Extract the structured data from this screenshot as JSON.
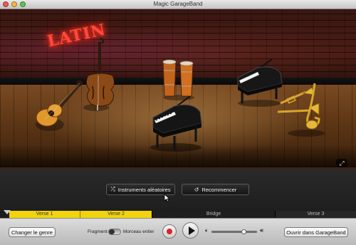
{
  "window": {
    "title": "Magic GarageBand"
  },
  "stage": {
    "sign_text": "LATIN",
    "instruments": [
      {
        "name": "acoustic-guitar"
      },
      {
        "name": "upright-bass"
      },
      {
        "name": "congas"
      },
      {
        "name": "grand-piano"
      },
      {
        "name": "second-piano"
      },
      {
        "name": "horns"
      }
    ],
    "expand_icon": "expand-icon"
  },
  "controls": {
    "shuffle_label": "Instruments aléatoires",
    "reset_label": "Recommencer"
  },
  "timeline": {
    "segments": [
      {
        "label": "Verse 1",
        "active": true
      },
      {
        "label": "Verse 2",
        "active": true
      },
      {
        "label": "Bridge",
        "active": false
      },
      {
        "label": "Verse 3",
        "active": false
      }
    ]
  },
  "bottom": {
    "change_genre_label": "Changer le genre",
    "fragment_label": "Fragment",
    "full_song_label": "Morceau entier",
    "open_label": "Ouvrir dans GarageBand",
    "volume_level": 0.75
  },
  "colors": {
    "accent_yellow": "#f1d40e",
    "record_red": "#d8262a"
  }
}
